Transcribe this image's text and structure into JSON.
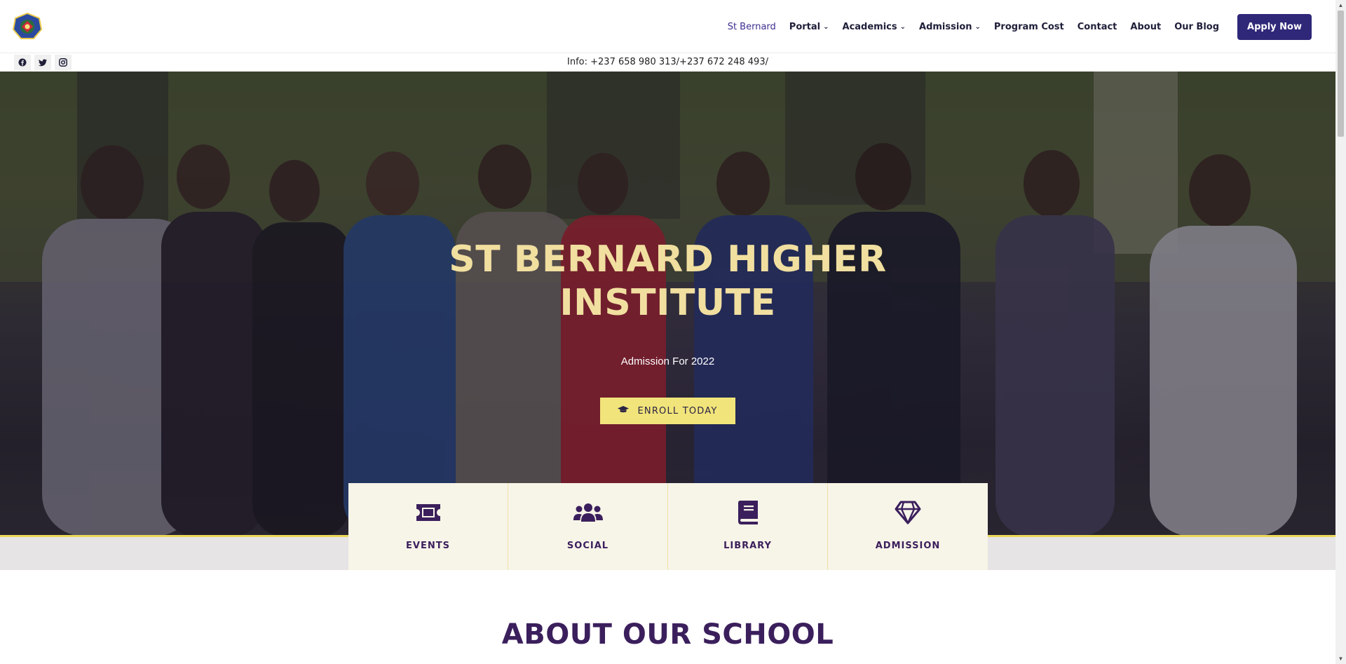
{
  "header": {
    "logo_icon": "school-crest-logo",
    "nav": [
      {
        "label": "St Bernard",
        "dropdown": false,
        "active": true
      },
      {
        "label": "Portal",
        "dropdown": true
      },
      {
        "label": "Academics",
        "dropdown": true
      },
      {
        "label": "Admission",
        "dropdown": true
      },
      {
        "label": "Program Cost",
        "dropdown": false
      },
      {
        "label": "Contact",
        "dropdown": false
      },
      {
        "label": "About",
        "dropdown": false
      },
      {
        "label": "Our Blog",
        "dropdown": false
      }
    ],
    "apply_label": "Apply Now"
  },
  "topbar": {
    "social": [
      "facebook-icon",
      "twitter-icon",
      "instagram-icon"
    ],
    "info": "Info: +237 658 980 313/+237 672 248 493/"
  },
  "hero": {
    "title": "ST BERNARD HIGHER INSTITUTE",
    "subtitle": "Admission For 2022",
    "cta_label": "ENROLL TODAY",
    "cta_icon": "graduation-cap-icon"
  },
  "features": [
    {
      "label": "EVENTS",
      "icon": "ticket-icon"
    },
    {
      "label": "SOCIAL",
      "icon": "users-icon"
    },
    {
      "label": "LIBRARY",
      "icon": "book-icon"
    },
    {
      "label": "ADMISSION",
      "icon": "diamond-icon"
    }
  ],
  "about": {
    "title": "ABOUT OUR SCHOOL"
  },
  "colors": {
    "brand_purple": "#2f2778",
    "heading_purple": "#3b1f5c",
    "hero_title": "#f1dfa0",
    "cta_yellow": "#f1e47a",
    "feature_bg": "#f7f4e8"
  }
}
